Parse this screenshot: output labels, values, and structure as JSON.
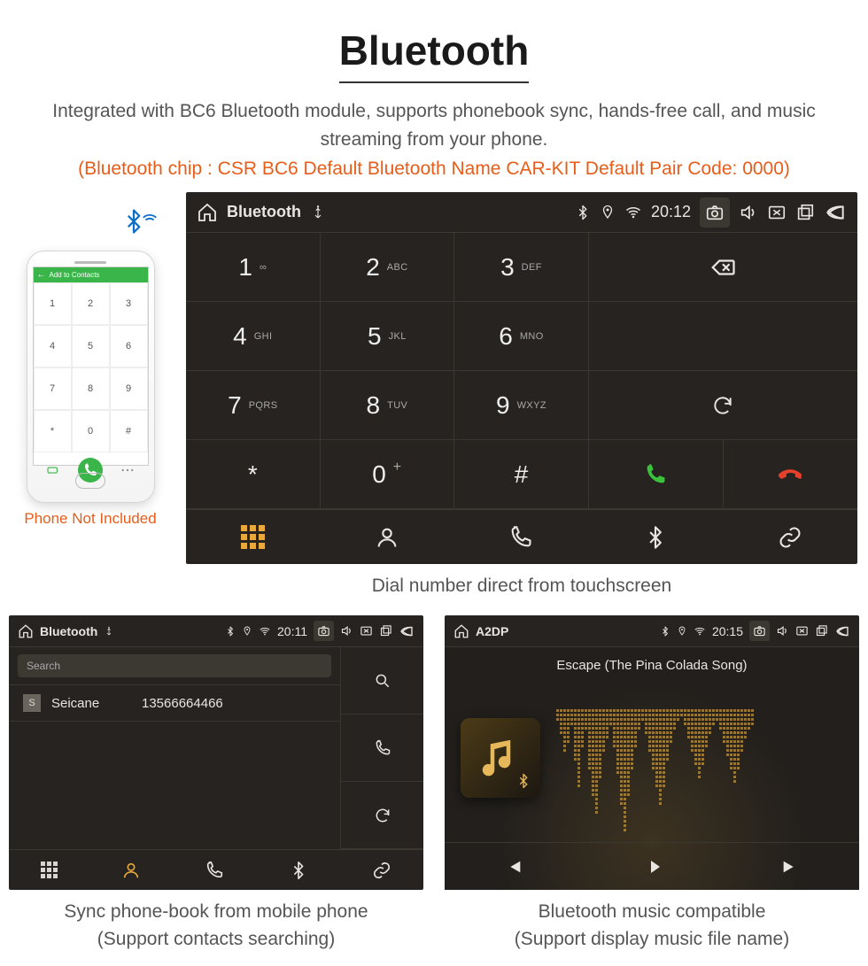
{
  "title": "Bluetooth",
  "subtitle": "Integrated with BC6 Bluetooth module, supports phonebook sync, hands-free call, and music streaming from your phone.",
  "specline": "(Bluetooth chip : CSR BC6    Default Bluetooth Name CAR-KIT    Default Pair Code: 0000)",
  "phone": {
    "header": "Add to Contacts",
    "keys": [
      "1",
      "2",
      "3",
      "4",
      "5",
      "6",
      "7",
      "8",
      "9",
      "*",
      "0",
      "#"
    ],
    "caption": "Phone Not Included"
  },
  "dialer_unit": {
    "app_name": "Bluetooth",
    "time": "20:12",
    "keys": [
      {
        "n": "1",
        "s": "∞"
      },
      {
        "n": "2",
        "s": "ABC"
      },
      {
        "n": "3",
        "s": "DEF"
      },
      {
        "n": "4",
        "s": "GHI"
      },
      {
        "n": "5",
        "s": "JKL"
      },
      {
        "n": "6",
        "s": "MNO"
      },
      {
        "n": "7",
        "s": "PQRS"
      },
      {
        "n": "8",
        "s": "TUV"
      },
      {
        "n": "9",
        "s": "WXYZ"
      },
      {
        "n": "*",
        "s": ""
      },
      {
        "n": "0",
        "s": "+"
      },
      {
        "n": "#",
        "s": ""
      }
    ],
    "caption": "Dial number direct from touchscreen"
  },
  "contacts_unit": {
    "app_name": "Bluetooth",
    "time": "20:11",
    "search_placeholder": "Search",
    "contact_letter": "S",
    "contact_name": "Seicane",
    "contact_number": "13566664466",
    "caption_l1": "Sync phone-book from mobile phone",
    "caption_l2": "(Support contacts searching)"
  },
  "music_unit": {
    "app_name": "A2DP",
    "time": "20:15",
    "song": "Escape (The Pina Colada Song)",
    "caption_l1": "Bluetooth music compatible",
    "caption_l2": "(Support display music file name)"
  }
}
